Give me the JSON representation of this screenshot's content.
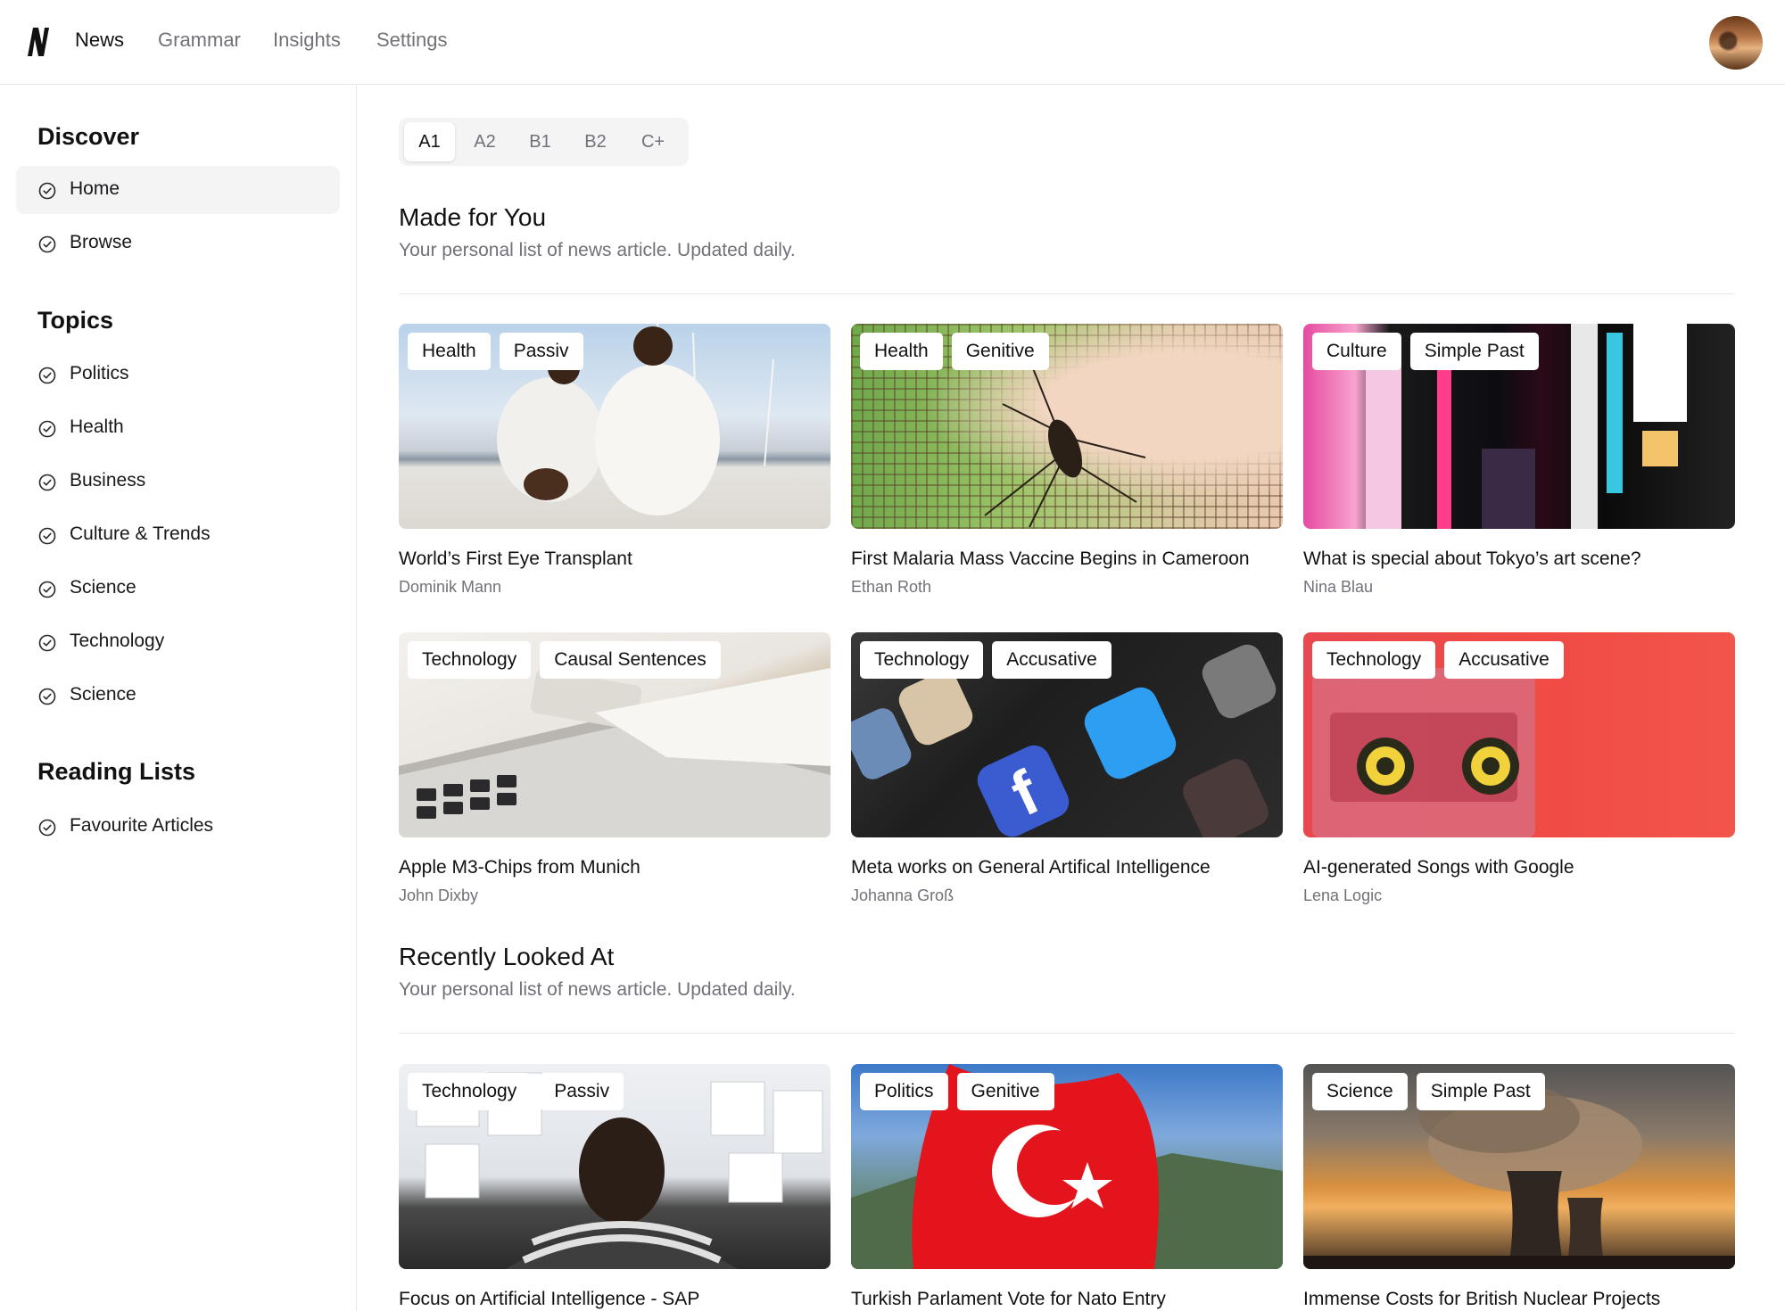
{
  "nav": {
    "logo": "N",
    "links": [
      {
        "label": "News",
        "active": true
      },
      {
        "label": "Grammar",
        "active": false
      },
      {
        "label": "Insights",
        "active": false
      },
      {
        "label": "Settings",
        "active": false
      }
    ]
  },
  "sidebar": {
    "discover": {
      "heading": "Discover",
      "items": [
        {
          "label": "Home",
          "active": true,
          "icon": "check-circle-icon"
        },
        {
          "label": "Browse",
          "active": false,
          "icon": "check-circle-icon"
        }
      ]
    },
    "topics": {
      "heading": "Topics",
      "items": [
        {
          "label": "Politics",
          "icon": "check-circle-icon"
        },
        {
          "label": "Health",
          "icon": "check-circle-icon"
        },
        {
          "label": "Business",
          "icon": "check-circle-icon"
        },
        {
          "label": "Culture & Trends",
          "icon": "check-circle-icon"
        },
        {
          "label": "Science",
          "icon": "check-circle-icon"
        },
        {
          "label": "Technology",
          "icon": "check-circle-icon"
        },
        {
          "label": "Science",
          "icon": "check-circle-icon"
        }
      ]
    },
    "reading_lists": {
      "heading": "Reading Lists",
      "items": [
        {
          "label": "Favourite Articles",
          "icon": "check-circle-icon"
        }
      ]
    }
  },
  "levels": {
    "options": [
      "A1",
      "A2",
      "B1",
      "B2",
      "C+"
    ],
    "selected": "A1"
  },
  "made_for_you": {
    "title": "Made for You",
    "subtitle": "Your personal list of news article. Updated daily.",
    "cards": [
      {
        "tags": [
          "Health",
          "Passiv"
        ],
        "title": "World’s First Eye Transplant",
        "author": "Dominik Mann"
      },
      {
        "tags": [
          "Health",
          "Genitive"
        ],
        "title": "First Malaria Mass Vaccine Begins in Cameroon",
        "author": "Ethan Roth"
      },
      {
        "tags": [
          "Culture",
          "Simple Past"
        ],
        "title": "What is special about Tokyo’s art scene?",
        "author": "Nina Blau"
      },
      {
        "tags": [
          "Technology",
          "Causal Sentences"
        ],
        "title": "Apple M3-Chips from Munich",
        "author": "John Dixby"
      },
      {
        "tags": [
          "Technology",
          "Accusative"
        ],
        "title": "Meta works on General Artifical Intelligence",
        "author": "Johanna Groß"
      },
      {
        "tags": [
          "Technology",
          "Accusative"
        ],
        "title": "AI-generated Songs with Google",
        "author": "Lena Logic"
      }
    ]
  },
  "recently_looked_at": {
    "title": "Recently Looked At",
    "subtitle": "Your personal list of news article. Updated daily.",
    "cards": [
      {
        "tags": [
          "Technology",
          "Passiv"
        ],
        "title": "Focus on Artificial Intelligence - SAP"
      },
      {
        "tags": [
          "Politics",
          "Genitive"
        ],
        "title": "Turkish Parlament Vote for Nato Entry"
      },
      {
        "tags": [
          "Science",
          "Simple Past"
        ],
        "title": "Immense Costs for British Nuclear Projects"
      }
    ]
  }
}
